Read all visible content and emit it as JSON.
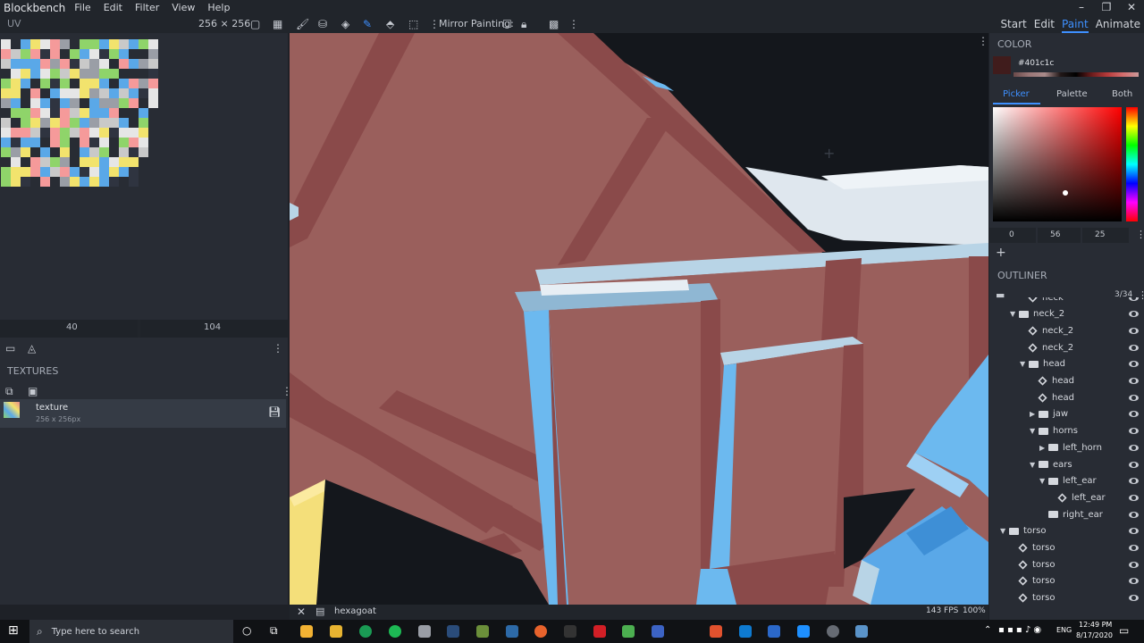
{
  "app": {
    "title": "Blockbench"
  },
  "menu": [
    "File",
    "Edit",
    "Filter",
    "View",
    "Help"
  ],
  "window_controls": [
    "–",
    "❐",
    "✕"
  ],
  "toolbar": {
    "uv_size": "256 ⨯ 256",
    "mirror_painting_label": "Mirror Painting:"
  },
  "modes": [
    {
      "label": "Start",
      "selected": false
    },
    {
      "label": "Edit",
      "selected": false
    },
    {
      "label": "Paint",
      "selected": true
    },
    {
      "label": "Animate",
      "selected": false
    }
  ],
  "uv_panel": {
    "title": "UV",
    "field_x": "40",
    "field_y": "104"
  },
  "textures_panel": {
    "title": "TEXTURES",
    "texture_name": "texture",
    "texture_size": "256 x 256px"
  },
  "color_panel": {
    "title": "COLOR",
    "hex": "#401c1c",
    "main_color": "#401c1c",
    "tabs": [
      "Picker",
      "Palette",
      "Both"
    ],
    "hsv": [
      "0",
      "56",
      "25"
    ],
    "add": "+"
  },
  "outliner": {
    "title": "OUTLINER",
    "count": "3/34",
    "items": [
      {
        "label": "neck",
        "type": "cube",
        "depth": 2
      },
      {
        "label": "neck_2",
        "type": "folder",
        "depth": 1,
        "expanded": true
      },
      {
        "label": "neck_2",
        "type": "cube",
        "depth": 2
      },
      {
        "label": "neck_2",
        "type": "cube",
        "depth": 2
      },
      {
        "label": "head",
        "type": "folder",
        "depth": 2,
        "expanded": true
      },
      {
        "label": "head",
        "type": "cube",
        "depth": 3
      },
      {
        "label": "head",
        "type": "cube",
        "depth": 3
      },
      {
        "label": "jaw",
        "type": "folder",
        "depth": 3,
        "expanded": false
      },
      {
        "label": "horns",
        "type": "folder",
        "depth": 3,
        "expanded": true
      },
      {
        "label": "left_horn",
        "type": "folder",
        "depth": 4,
        "expanded": false
      },
      {
        "label": "ears",
        "type": "folder",
        "depth": 3,
        "expanded": true
      },
      {
        "label": "left_ear",
        "type": "folder",
        "depth": 4,
        "expanded": true
      },
      {
        "label": "left_ear",
        "type": "cube",
        "depth": 5
      },
      {
        "label": "right_ear",
        "type": "folder",
        "depth": 4,
        "expanded": null
      },
      {
        "label": "torso",
        "type": "folder",
        "depth": 0,
        "expanded": true
      },
      {
        "label": "torso",
        "type": "cube",
        "depth": 1
      },
      {
        "label": "torso",
        "type": "cube",
        "depth": 1
      },
      {
        "label": "torso",
        "type": "cube",
        "depth": 1
      },
      {
        "label": "torso",
        "type": "cube",
        "depth": 1
      }
    ]
  },
  "viewport_status": {
    "project": "hexagoat",
    "fps": "143 FPS",
    "zoom": "100%"
  },
  "taskbar": {
    "search_placeholder": "Type here to search",
    "lang": "ENG",
    "time": "12:49 PM",
    "date": "8/17/2020"
  },
  "colors": {
    "model_body": "#9a5f5c",
    "model_edge": "#8a4a4a",
    "model_trim_blue": "#6cb9ef",
    "accent": "#3e90ff"
  }
}
